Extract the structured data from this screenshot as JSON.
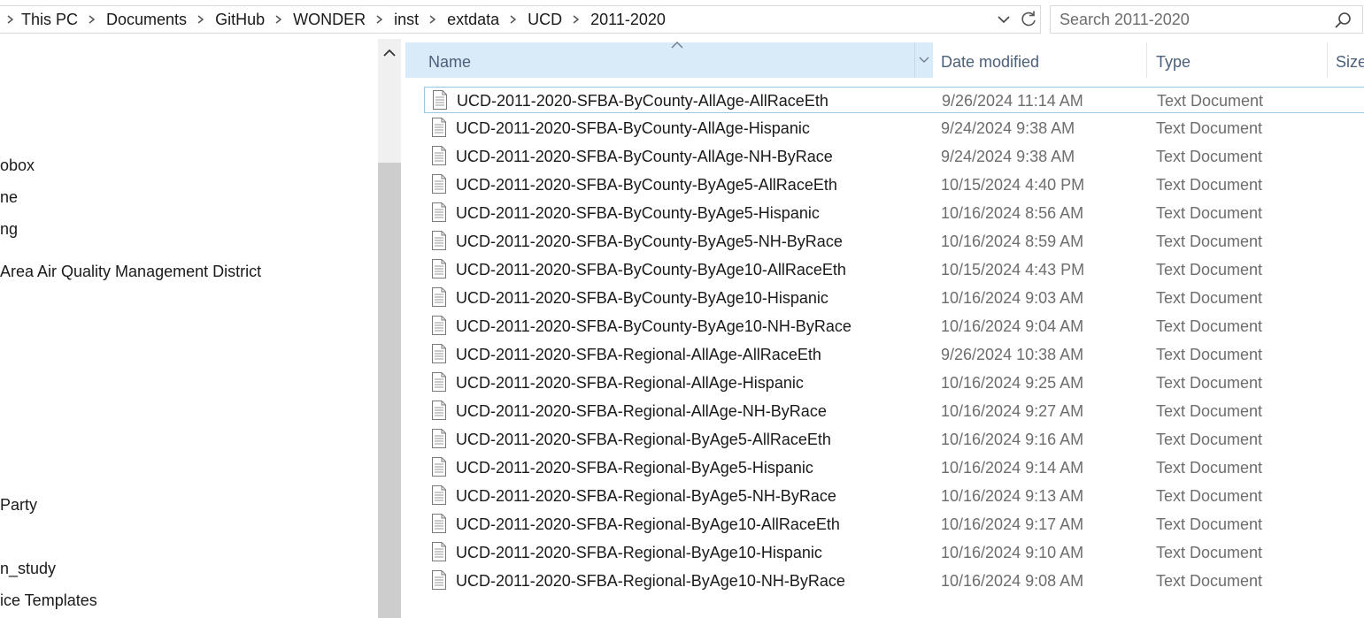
{
  "breadcrumb": [
    "This PC",
    "Documents",
    "GitHub",
    "WONDER",
    "inst",
    "extdata",
    "UCD",
    "2011-2020"
  ],
  "search": {
    "placeholder": "Search 2011-2020"
  },
  "nav": {
    "items": [
      "obox",
      "ne",
      "ng",
      " Area Air Quality Management District",
      "Party",
      "n_study",
      "ice Templates"
    ]
  },
  "columns": {
    "name": "Name",
    "date": "Date modified",
    "type": "Type",
    "size": "Size"
  },
  "files": [
    {
      "name": "UCD-2011-2020-SFBA-ByCounty-AllAge-AllRaceEth",
      "date": "9/26/2024 11:14 AM",
      "type": "Text Document"
    },
    {
      "name": "UCD-2011-2020-SFBA-ByCounty-AllAge-Hispanic",
      "date": "9/24/2024 9:38 AM",
      "type": "Text Document"
    },
    {
      "name": "UCD-2011-2020-SFBA-ByCounty-AllAge-NH-ByRace",
      "date": "9/24/2024 9:38 AM",
      "type": "Text Document"
    },
    {
      "name": "UCD-2011-2020-SFBA-ByCounty-ByAge5-AllRaceEth",
      "date": "10/15/2024 4:40 PM",
      "type": "Text Document"
    },
    {
      "name": "UCD-2011-2020-SFBA-ByCounty-ByAge5-Hispanic",
      "date": "10/16/2024 8:56 AM",
      "type": "Text Document"
    },
    {
      "name": "UCD-2011-2020-SFBA-ByCounty-ByAge5-NH-ByRace",
      "date": "10/16/2024 8:59 AM",
      "type": "Text Document"
    },
    {
      "name": "UCD-2011-2020-SFBA-ByCounty-ByAge10-AllRaceEth",
      "date": "10/15/2024 4:43 PM",
      "type": "Text Document"
    },
    {
      "name": "UCD-2011-2020-SFBA-ByCounty-ByAge10-Hispanic",
      "date": "10/16/2024 9:03 AM",
      "type": "Text Document"
    },
    {
      "name": "UCD-2011-2020-SFBA-ByCounty-ByAge10-NH-ByRace",
      "date": "10/16/2024 9:04 AM",
      "type": "Text Document"
    },
    {
      "name": "UCD-2011-2020-SFBA-Regional-AllAge-AllRaceEth",
      "date": "9/26/2024 10:38 AM",
      "type": "Text Document"
    },
    {
      "name": "UCD-2011-2020-SFBA-Regional-AllAge-Hispanic",
      "date": "10/16/2024 9:25 AM",
      "type": "Text Document"
    },
    {
      "name": "UCD-2011-2020-SFBA-Regional-AllAge-NH-ByRace",
      "date": "10/16/2024 9:27 AM",
      "type": "Text Document"
    },
    {
      "name": "UCD-2011-2020-SFBA-Regional-ByAge5-AllRaceEth",
      "date": "10/16/2024 9:16 AM",
      "type": "Text Document"
    },
    {
      "name": "UCD-2011-2020-SFBA-Regional-ByAge5-Hispanic",
      "date": "10/16/2024 9:14 AM",
      "type": "Text Document"
    },
    {
      "name": "UCD-2011-2020-SFBA-Regional-ByAge5-NH-ByRace",
      "date": "10/16/2024 9:13 AM",
      "type": "Text Document"
    },
    {
      "name": "UCD-2011-2020-SFBA-Regional-ByAge10-AllRaceEth",
      "date": "10/16/2024 9:17 AM",
      "type": "Text Document"
    },
    {
      "name": "UCD-2011-2020-SFBA-Regional-ByAge10-Hispanic",
      "date": "10/16/2024 9:10 AM",
      "type": "Text Document"
    },
    {
      "name": "UCD-2011-2020-SFBA-Regional-ByAge10-NH-ByRace",
      "date": "10/16/2024 9:08 AM",
      "type": "Text Document"
    }
  ]
}
